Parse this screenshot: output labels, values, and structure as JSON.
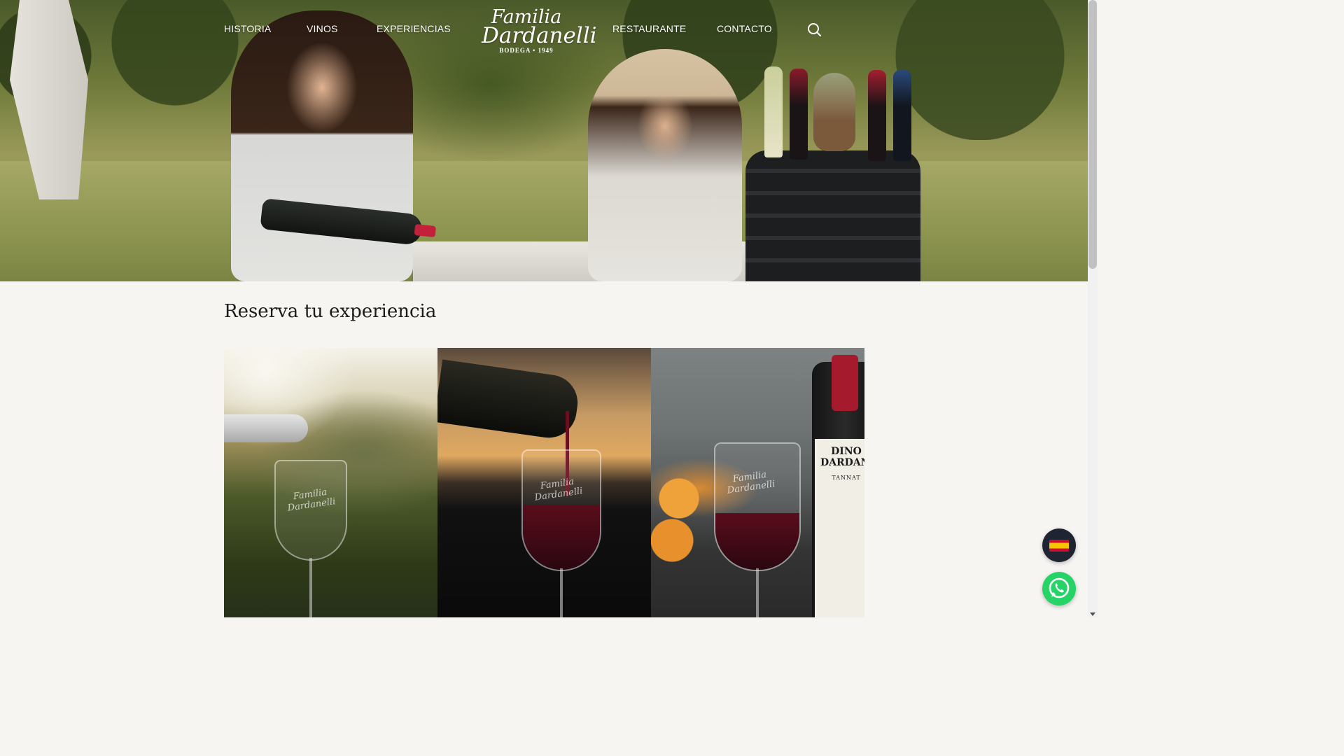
{
  "nav": {
    "items": [
      {
        "label": "HISTORIA"
      },
      {
        "label": "VINOS"
      },
      {
        "label": "EXPERIENCIAS"
      },
      {
        "label": "RESTAURANTE"
      },
      {
        "label": "CONTACTO"
      }
    ],
    "logo": {
      "line1": "Familia",
      "line2": "Dardanelli",
      "tagline": "BODEGA • 1949"
    },
    "search_icon": "search-icon"
  },
  "hero": {
    "image": "two women pouring red wine at an outdoor table with wine bottles on a black barrel"
  },
  "section": {
    "title": "Reserva tu experiencia"
  },
  "cards": [
    {
      "glass_text": "Familia Dardanelli"
    },
    {
      "glass_text": "Familia Dardanelli"
    },
    {
      "glass_text": "Familia Dardanelli",
      "bottle_name": "DINO DARDANELLI",
      "bottle_variety": "TANNAT"
    }
  ],
  "floating": {
    "language": "es",
    "language_icon": "spain-flag-icon",
    "whatsapp_icon": "whatsapp-icon"
  },
  "colors": {
    "page_bg": "#f6f5f2",
    "nav_text": "#ffffff",
    "whatsapp": "#25d366",
    "lang_bg": "#1f2432"
  }
}
